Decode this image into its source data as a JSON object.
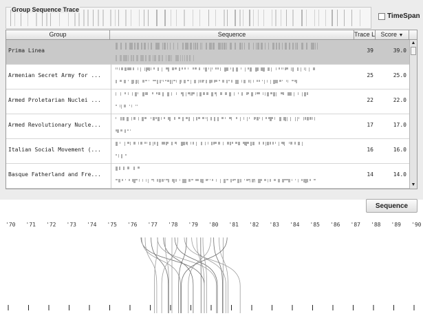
{
  "trace_panel": {
    "title": "Group Sequence Trace",
    "timespan_label": "TimeSpan",
    "timespan_checked": false
  },
  "table": {
    "columns": [
      "Group",
      "Sequence",
      "Trace L...",
      "Score"
    ],
    "sort_indicator": "▼",
    "rows": [
      {
        "group": "Prima Linea",
        "trace_length": "39",
        "score": "39.0",
        "selected": true
      },
      {
        "group": "Armenian Secret Army for ...",
        "trace_length": "25",
        "score": "25.0",
        "selected": false
      },
      {
        "group": "Armed Proletarian Nuclei ...",
        "trace_length": "22",
        "score": "22.0",
        "selected": false
      },
      {
        "group": "Armed Revolutionary Nucle...",
        "trace_length": "17",
        "score": "17.0",
        "selected": false
      },
      {
        "group": "Italian Social Movement (...",
        "trace_length": "16",
        "score": "16.0",
        "selected": false
      },
      {
        "group": "Basque Fatherland and Fre...",
        "trace_length": "14",
        "score": "14.0",
        "selected": false
      }
    ]
  },
  "sequence_button": "Sequence",
  "timeline": {
    "year_labels": [
      "'70",
      "'71",
      "'72",
      "'73",
      "'74",
      "'75",
      "'76",
      "'77",
      "'78",
      "'79",
      "'80",
      "'81",
      "'82",
      "'83",
      "'84",
      "'85",
      "'86",
      "'87",
      "'88",
      "'89",
      "'90"
    ]
  },
  "colors": {
    "panel_bg": "#ececec",
    "selected_row": "#c9c9c9",
    "bar_gray": "#a9a9a9",
    "line_gray": "#8a8a8a"
  }
}
